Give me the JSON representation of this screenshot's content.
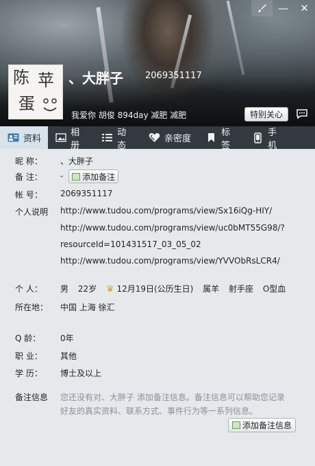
{
  "window": {
    "buttons": {
      "skin_icon": "brush-icon",
      "minimize": "—",
      "close": "✕"
    }
  },
  "profile": {
    "nickname": "、大胖子",
    "qq_number": "2069351117",
    "signature": "我爱你  胡俊  894day  减肥 减肥",
    "avatar_text": [
      "陈",
      "苹",
      "蛋"
    ],
    "special_care_label": "特别关心"
  },
  "tabs": [
    {
      "label": "资料",
      "icon": "id-card-icon",
      "active": true
    },
    {
      "label": "相册",
      "icon": "photo-icon"
    },
    {
      "label": "动态",
      "icon": "list-icon"
    },
    {
      "label": "亲密度",
      "icon": "heart-icon"
    },
    {
      "label": "标签",
      "icon": "bookmark-icon"
    },
    {
      "label": "手机",
      "icon": "phone-icon"
    }
  ],
  "details": {
    "nickname_label": "昵    称：",
    "nickname_value": "、大胖子",
    "remark_label": "备    注：",
    "remark_value": "-",
    "add_remark_button": "添加备注",
    "account_label": "帐    号：",
    "account_value": "2069351117",
    "personal_desc_label": "个人说明",
    "personal_desc_lines": [
      "http://www.tudou.com/programs/view/Sx16iQg-HIY/",
      "http://www.tudou.com/programs/view/uc0bMT55G98/?",
      "resourceId=101431517_03_05_02",
      "http://www.tudou.com/programs/view/YVVObRsLCR4/"
    ],
    "person_label": "个    人：",
    "gender": "男",
    "age": "22岁",
    "birthday": "12月19日(公历生日)",
    "birthday_icon": "crown-icon",
    "zodiac": "属羊",
    "constellation": "射手座",
    "blood_type": "O型血",
    "location_label": "所在地：",
    "location_value": "中国 上海 徐汇",
    "qage_label": "Q    龄：",
    "qage_value": "0年",
    "job_label": "职    业：",
    "job_value": "其他",
    "education_label": "学    历：",
    "education_value": "博士及以上",
    "remark_info_label": "备注信息",
    "remark_info_text_1": "您还没有对、大胖子 添加备注信息。备注信息可以帮助您记录",
    "remark_info_text_2": "好友的真实资料、联系方式、事件行为等一系列信息。",
    "add_remark_info_button": "添加备注信息"
  }
}
